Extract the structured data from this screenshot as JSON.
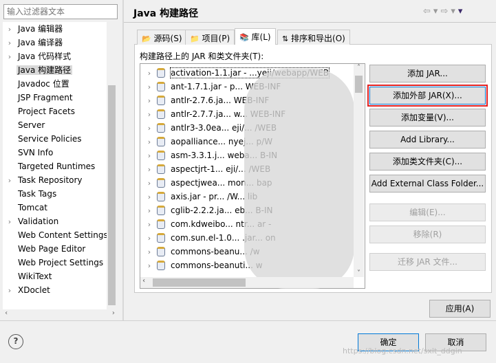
{
  "filter": {
    "placeholder": "输入过滤器文本"
  },
  "sidebar": {
    "items": [
      {
        "label": "Java 编辑器",
        "expandable": true
      },
      {
        "label": "Java 编译器",
        "expandable": true
      },
      {
        "label": "Java 代码样式",
        "expandable": true
      },
      {
        "label": "Java 构建路径",
        "expandable": false,
        "selected": true
      },
      {
        "label": "Javadoc 位置",
        "expandable": false
      },
      {
        "label": "JSP Fragment",
        "expandable": false
      },
      {
        "label": "Project Facets",
        "expandable": false
      },
      {
        "label": "Server",
        "expandable": false
      },
      {
        "label": "Service Policies",
        "expandable": false
      },
      {
        "label": "SVN Info",
        "expandable": false
      },
      {
        "label": "Targeted Runtimes",
        "expandable": false
      },
      {
        "label": "Task Repository",
        "expandable": true
      },
      {
        "label": "Task Tags",
        "expandable": false
      },
      {
        "label": "Tomcat",
        "expandable": false
      },
      {
        "label": "Validation",
        "expandable": true
      },
      {
        "label": "Web Content Settings",
        "expandable": false
      },
      {
        "label": "Web Page Editor",
        "expandable": false
      },
      {
        "label": "Web Project Settings",
        "expandable": false
      },
      {
        "label": "WikiText",
        "expandable": false
      },
      {
        "label": "XDoclet",
        "expandable": true
      }
    ]
  },
  "header": {
    "title": "Java 构建路径"
  },
  "tabs": [
    {
      "label": "源码(S)",
      "icon": "source-folder-icon"
    },
    {
      "label": "项目(P)",
      "icon": "project-folder-icon"
    },
    {
      "label": "库(L)",
      "icon": "library-icon",
      "active": true
    },
    {
      "label": "排序和导出(O)",
      "icon": "order-export-icon"
    }
  ],
  "list": {
    "label": "构建路径上的 JAR 和类文件夹(T):",
    "rows": [
      "activation-1.1.jar - ...yeji/webapp/WEB",
      "ant-1.7.1.jar - p... WEB-INF",
      "antlr-2.7.6.ja... WEB-INF",
      "antlr-2.7.7.ja... w... WEB-INF",
      "antlr3-3.0ea... eji/... /WEB",
      "aopalliance... nyej... p/W",
      "asm-3.3.1.j... weba... B-IN",
      "aspectjrt-1... eji/... /WEB",
      "aspectjwea... mon... bap",
      "axis.jar - pr... /W... lib",
      "cglib-2.2.2.ja... eb... B-IN",
      "com.kdweibo... ntr... ar -",
      "com.sun.el-1.0... .jar... on",
      "commons-beanu... /w",
      "commons-beanuti... w"
    ]
  },
  "buttons": [
    {
      "label": "添加 JAR...",
      "enabled": true
    },
    {
      "label": "添加外部 JAR(X)...",
      "enabled": true,
      "highlighted": true
    },
    {
      "label": "添加变量(V)...",
      "enabled": true
    },
    {
      "label": "Add Library...",
      "enabled": true
    },
    {
      "label": "添加类文件夹(C)...",
      "enabled": true
    },
    {
      "label": "Add External Class Folder...",
      "enabled": true
    },
    {
      "label": "编辑(E)...",
      "enabled": false
    },
    {
      "label": "移除(R)",
      "enabled": false
    },
    {
      "label": "迁移 JAR 文件...",
      "enabled": false
    }
  ],
  "apply": "应用(A)",
  "footer": {
    "help": "?",
    "ok": "确定",
    "cancel": "取消",
    "watermark": "https://blog.csdn.net/sxlt_ddgin"
  },
  "colors": {
    "highlight": "#e02020",
    "focus": "#0078d7"
  }
}
